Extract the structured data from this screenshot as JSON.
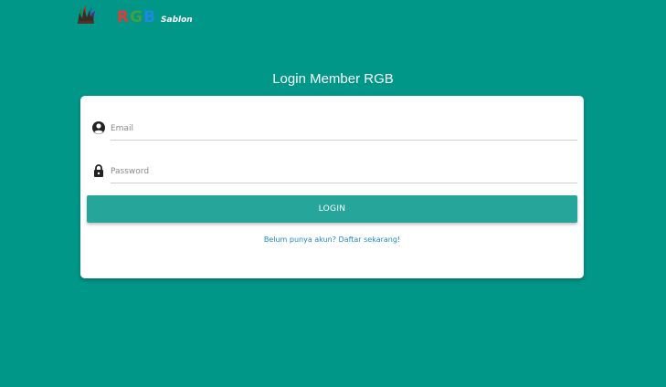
{
  "header": {
    "logo_icon": "paint-splash-logo-icon",
    "brand": {
      "r": "R",
      "g": "G",
      "b": "B",
      "subtitle": "Sablon"
    }
  },
  "login": {
    "title": "Login Member RGB",
    "email": {
      "icon": "account-circle-icon",
      "placeholder": "Email",
      "value": ""
    },
    "password": {
      "icon": "lock-icon",
      "placeholder": "Password",
      "value": ""
    },
    "submit_label": "LOGIN",
    "register_link": "Belum punya akun? Daftar sekarang!"
  },
  "colors": {
    "background": "#009688",
    "button": "#26a69a",
    "link": "#1e88c8"
  }
}
